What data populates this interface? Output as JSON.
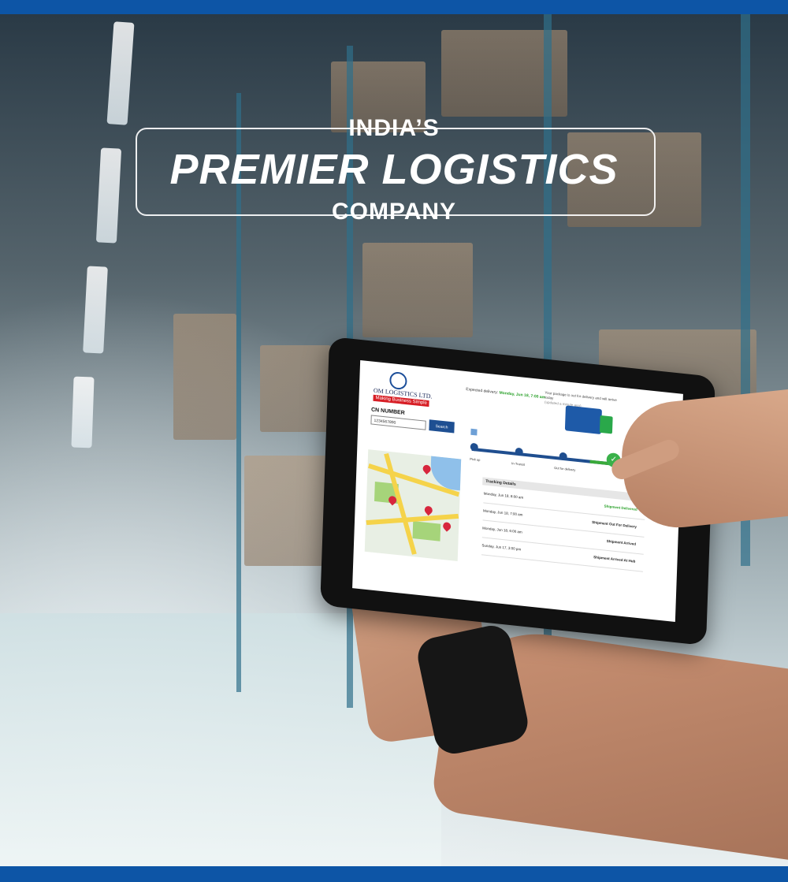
{
  "headline": {
    "line1": "INDIA’S",
    "line2": "PREMIER LOGISTICS",
    "line3": "COMPANY"
  },
  "tablet_screen": {
    "logo_name": "OM LOGISTICS LTD.",
    "logo_tagline": "Making Business Simple",
    "expected_delivery_label": "Expected delivery:",
    "expected_delivery_value": "Monday, Jun 18, 7:00 am",
    "notice_line1": "Your package is out for delivery and will arrive today",
    "notice_line2": "(updated a minute ago)",
    "cn_label": "CN NUMBER",
    "cn_value": "1234567890",
    "search_label": "Search",
    "steps": [
      "Pick up",
      "In-Transit",
      "Out for delivery"
    ],
    "tracking_title": "Tracking Details",
    "tracking_rows": [
      {
        "date": "Monday, Jun 18, 8:00 am",
        "status": "Shipment Delivered"
      },
      {
        "date": "Monday, Jun 18, 7:00 am",
        "status": "Shipment Out For Delivery"
      },
      {
        "date": "Monday, Jun 18, 6:00 am",
        "status": "Shipment Arrived"
      },
      {
        "date": "Sunday, Jun 17, 3:00 pm",
        "status": "Shipment Arrived At Hub"
      }
    ]
  },
  "colors": {
    "brand_blue": "#0d55a6",
    "success_green": "#2aa12a",
    "logo_red": "#d71e25"
  }
}
